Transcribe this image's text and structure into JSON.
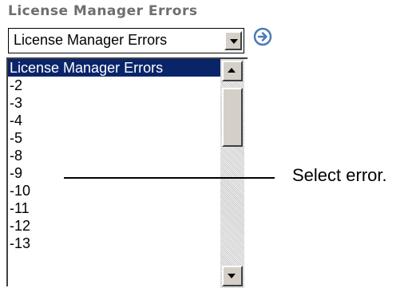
{
  "title": "License Manager Errors",
  "dropdown": {
    "selected_value": "License Manager Errors",
    "button_icon": "chevron-down-icon"
  },
  "go_button": {
    "icon": "arrow-right-circle-icon",
    "color": "#4a7ab8"
  },
  "listbox": {
    "selected_index": 0,
    "selected_color": "#0a246a",
    "items": [
      "License Manager Errors",
      "-2",
      "-3",
      "-4",
      "-5",
      "-8",
      "-9",
      "-10",
      "-11",
      "-12",
      "-13"
    ]
  },
  "annotation": {
    "text": "Select error."
  }
}
